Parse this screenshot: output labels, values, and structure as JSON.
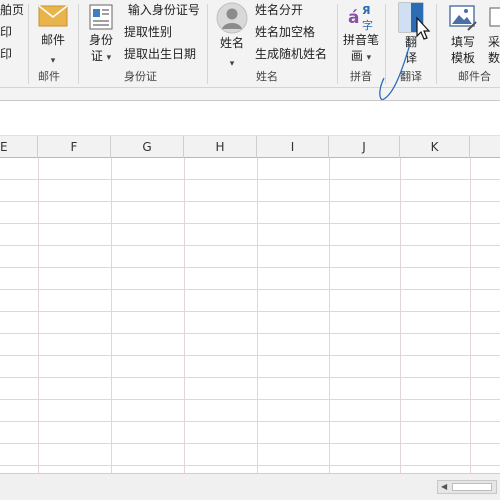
{
  "ribbon": {
    "partial_left": {
      "line1": "舶页",
      "line2": "印",
      "line3": "印"
    },
    "mail_group": {
      "button_label": "邮件",
      "group_label": "邮件"
    },
    "id_group": {
      "button_line1": "身份",
      "button_line2": "证",
      "items": [
        "输入身份证号",
        "提取性别",
        "提取出生日期"
      ],
      "group_label": "身份证"
    },
    "name_group": {
      "button_label": "姓名",
      "items": [
        "姓名分开",
        "姓名加空格",
        "生成随机姓名"
      ],
      "group_label": "姓名"
    },
    "pinyin_group": {
      "icon_text_a": "á",
      "icon_text_b": "Я",
      "icon_text_c": "字",
      "button_line1": "拼音笔",
      "button_line2": "画",
      "group_label": "拼音"
    },
    "translate_group": {
      "button_line1": "翻",
      "button_line2": "译",
      "group_label": "翻译"
    },
    "mailmerge_group": {
      "button_line1": "填写",
      "button_line2": "模板",
      "partial_line1": "采",
      "partial_line2": "数",
      "group_label": "邮件合"
    }
  },
  "sheet": {
    "columns": [
      "E",
      "F",
      "G",
      "H",
      "I",
      "J",
      "K"
    ]
  },
  "colors": {
    "ribbon_bg": "#f3f3f3",
    "grid_line": "#e3d4d8",
    "accent_blue": "#2b6cb5",
    "pinyin_purple": "#8a4fa8"
  }
}
